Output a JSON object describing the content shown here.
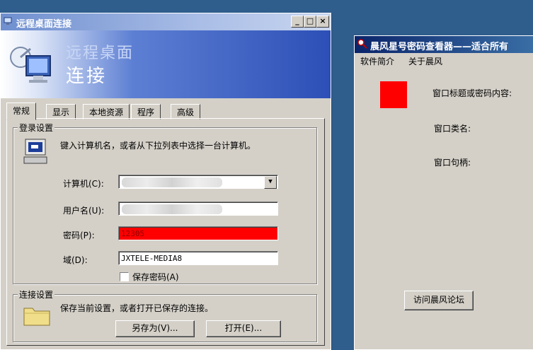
{
  "rdc": {
    "title": "远程桌面连接",
    "banner_line1": "远程桌面",
    "banner_line2": "连接",
    "tabs": [
      {
        "label": "常规"
      },
      {
        "label": "显示"
      },
      {
        "label": "本地资源"
      },
      {
        "label": "程序"
      },
      {
        "label": "高级"
      }
    ],
    "login_group": {
      "legend": "登录设置",
      "instruction": "键入计算机名，或者从下拉列表中选择一台计算机。",
      "computer_label": "计算机(C):",
      "username_label": "用户名(U):",
      "password_label": "密码(P):",
      "password_value": "12305",
      "domain_label": "域(D):",
      "domain_value": "JXTELE-MEDIA8",
      "save_password_label": "保存密码(A)"
    },
    "connect_group": {
      "legend": "连接设置",
      "instruction": "保存当前设置，或者打开已保存的连接。",
      "save_as_label": "另存为(V)...",
      "open_label": "打开(E)..."
    }
  },
  "pwv": {
    "title": "晨风星号密码查看器——适合所有",
    "menus": [
      {
        "label": "软件简介"
      },
      {
        "label": "关于晨风"
      }
    ],
    "field_window_title": "窗口标题或密码内容:",
    "field_class": "窗口类名:",
    "field_handle": "窗口句柄:",
    "forum_button": "访问晨风论坛",
    "target_color": "#ff0000"
  },
  "colors": {
    "desktop": "#2f5d8c",
    "window_face": "#d4d0c8",
    "password_highlight": "#ff0000"
  }
}
